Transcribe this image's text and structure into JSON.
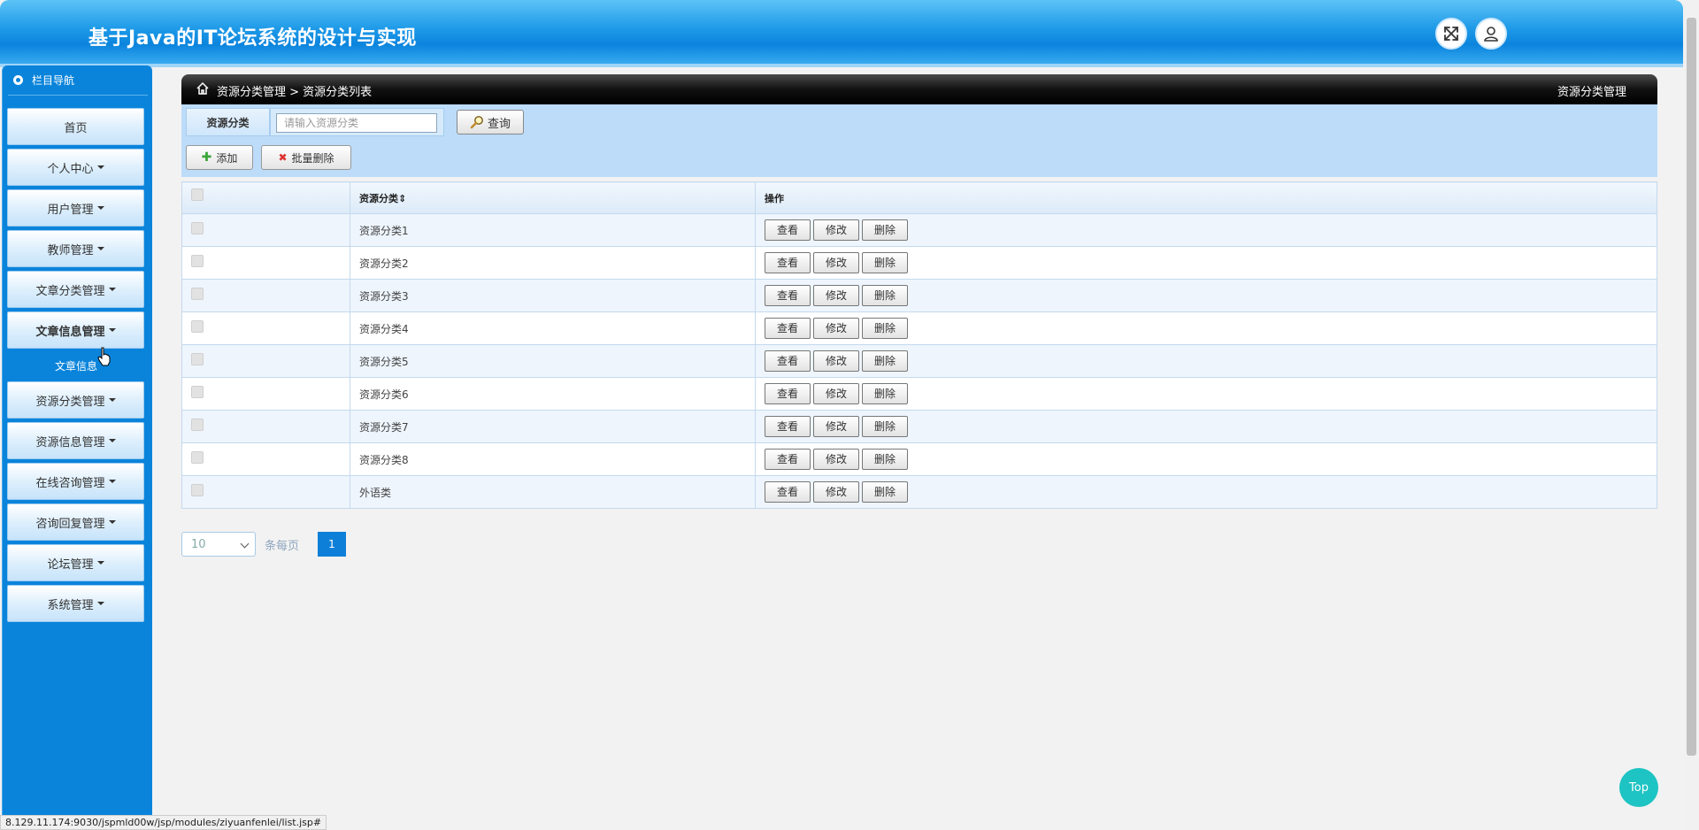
{
  "header": {
    "title": "基于Java的IT论坛系统的设计与实现",
    "icons": [
      "expand-icon",
      "user-icon"
    ]
  },
  "sidebar": {
    "heading": "栏目导航",
    "items": [
      {
        "label": "首页",
        "has_caret": false
      },
      {
        "label": "个人中心",
        "has_caret": true
      },
      {
        "label": "用户管理",
        "has_caret": true
      },
      {
        "label": "教师管理",
        "has_caret": true
      },
      {
        "label": "文章分类管理",
        "has_caret": true
      },
      {
        "label": "文章信息管理",
        "has_caret": true
      },
      {
        "label": "资源分类管理",
        "has_caret": true
      },
      {
        "label": "资源信息管理",
        "has_caret": true
      },
      {
        "label": "在线咨询管理",
        "has_caret": true
      },
      {
        "label": "咨询回复管理",
        "has_caret": true
      },
      {
        "label": "论坛管理",
        "has_caret": true
      },
      {
        "label": "系统管理",
        "has_caret": true
      }
    ],
    "submenu_item": "文章信息"
  },
  "breadcrumb": {
    "path": "资源分类管理 > 资源分类列表",
    "right_title": "资源分类管理"
  },
  "search": {
    "label": "资源分类",
    "placeholder": "请输入资源分类",
    "query_button": "查询",
    "add_button": "添加",
    "batch_delete_button": "批量删除"
  },
  "table": {
    "columns": [
      "",
      "资源分类",
      "操作"
    ],
    "sort_indicator": "⇕",
    "rows": [
      {
        "name": "资源分类1"
      },
      {
        "name": "资源分类2"
      },
      {
        "name": "资源分类3"
      },
      {
        "name": "资源分类4"
      },
      {
        "name": "资源分类5"
      },
      {
        "name": "资源分类6"
      },
      {
        "name": "资源分类7"
      },
      {
        "name": "资源分类8"
      },
      {
        "name": "外语类"
      }
    ],
    "actions": {
      "view": "查看",
      "edit": "修改",
      "delete": "删除"
    }
  },
  "pagination": {
    "page_size": "10",
    "per_page_label": "条每页",
    "current_page": "1"
  },
  "top_button": "Top",
  "status_url": "8.129.11.174:9030/jspmld00w/jsp/modules/ziyuanfenlei/list.jsp#"
}
